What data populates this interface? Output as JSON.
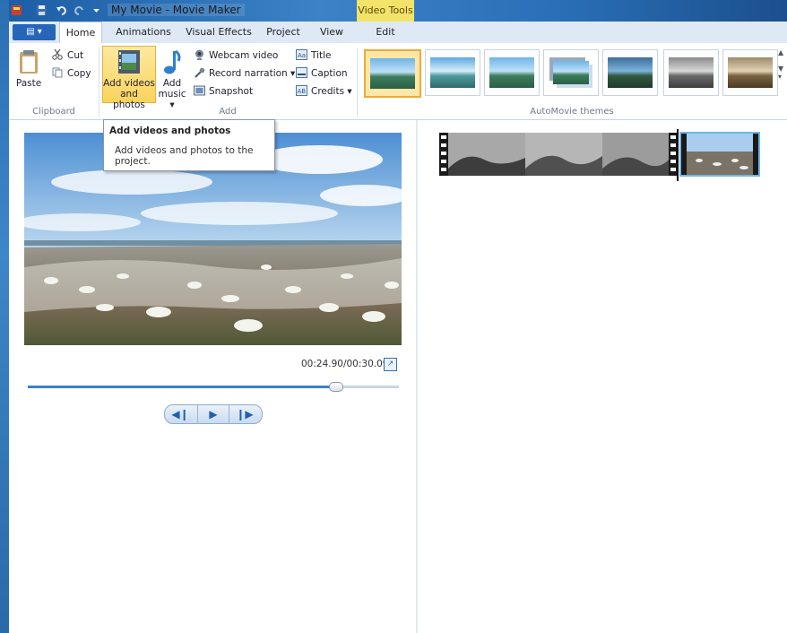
{
  "window": {
    "title": "My Movie - Movie Maker",
    "context_tab_group": "Video Tools",
    "accent": "#2a70b8",
    "context_color": "#f3e36b"
  },
  "tabs": [
    {
      "label": "Home",
      "active": true
    },
    {
      "label": "Animations",
      "active": false
    },
    {
      "label": "Visual Effects",
      "active": false
    },
    {
      "label": "Project",
      "active": false
    },
    {
      "label": "View",
      "active": false
    },
    {
      "label": "Edit",
      "active": false
    }
  ],
  "ribbon": {
    "clipboard": {
      "group": "Clipboard",
      "paste": "Paste",
      "cut": "Cut",
      "copy": "Copy"
    },
    "add": {
      "group": "Add",
      "add_videos_line1": "Add videos",
      "add_videos_line2": "and photos",
      "add_music_line1": "Add",
      "add_music_line2": "music",
      "webcam": "Webcam video",
      "narration": "Record narration",
      "snapshot": "Snapshot",
      "title": "Title",
      "caption": "Caption",
      "credits": "Credits"
    },
    "themes": {
      "group": "AutoMovie themes"
    }
  },
  "tooltip": {
    "title": "Add videos and photos",
    "body": "Add videos and photos to the project."
  },
  "player": {
    "timecode": "00:24.90/00:30.09",
    "progress": 0.8275
  },
  "icons": [
    "paste-icon",
    "cut-icon",
    "copy-icon",
    "film-icon",
    "music-note-icon",
    "webcam-icon",
    "microphone-icon",
    "camera-icon",
    "title-icon",
    "caption-icon",
    "credits-icon",
    "fullscreen-icon",
    "prev-frame-icon",
    "play-icon",
    "next-frame-icon"
  ]
}
